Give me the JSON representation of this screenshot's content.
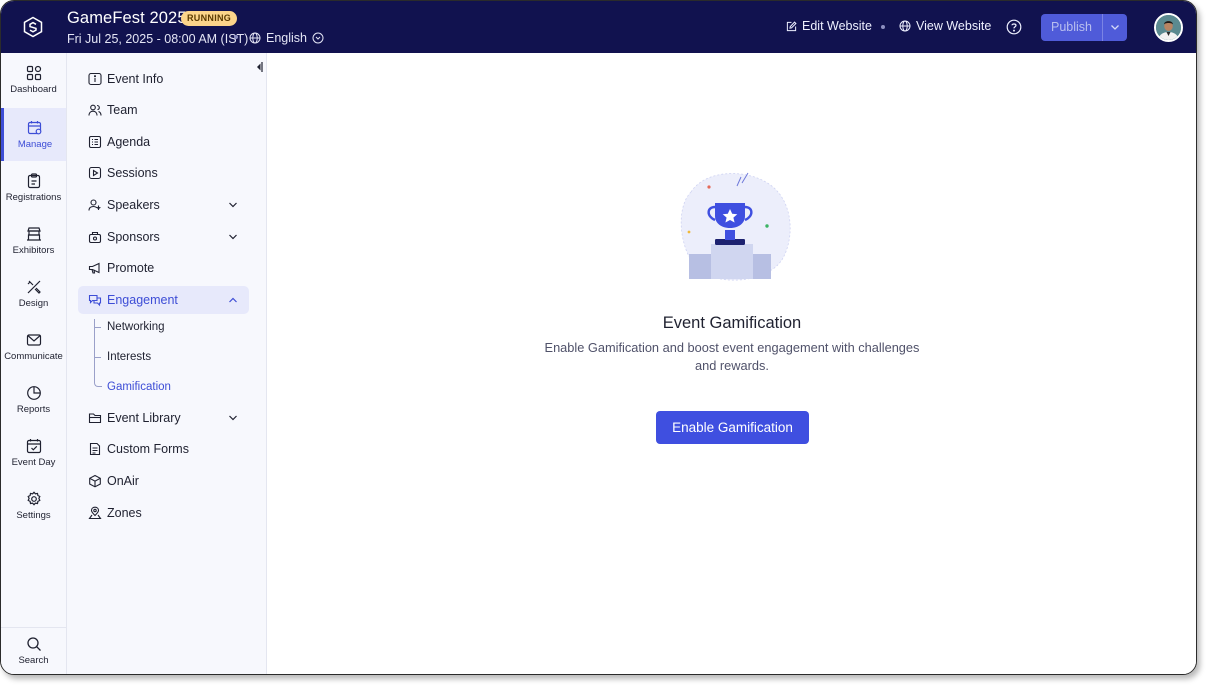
{
  "header": {
    "event_title": "GameFest 2025",
    "status_badge": "RUNNING",
    "event_date": "Fri Jul 25, 2025 - 08:00 AM (IST)",
    "language": "English",
    "edit_website": "Edit Website",
    "view_website": "View Website",
    "publish": "Publish"
  },
  "rail": {
    "items": [
      {
        "label": "Dashboard",
        "icon": "grid-icon"
      },
      {
        "label": "Manage",
        "icon": "calendar-gear-icon",
        "active": true
      },
      {
        "label": "Registrations",
        "icon": "clipboard-icon"
      },
      {
        "label": "Exhibitors",
        "icon": "booth-icon"
      },
      {
        "label": "Design",
        "icon": "pen-ruler-icon"
      },
      {
        "label": "Communicate",
        "icon": "envelope-icon"
      },
      {
        "label": "Reports",
        "icon": "pie-chart-icon"
      },
      {
        "label": "Event Day",
        "icon": "calendar-check-icon"
      },
      {
        "label": "Settings",
        "icon": "gear-icon"
      }
    ],
    "search": "Search"
  },
  "subnav": {
    "items": [
      {
        "label": "Event Info",
        "icon": "info-icon"
      },
      {
        "label": "Team",
        "icon": "people-icon"
      },
      {
        "label": "Agenda",
        "icon": "agenda-icon"
      },
      {
        "label": "Sessions",
        "icon": "play-icon"
      },
      {
        "label": "Speakers",
        "icon": "speaker-icon"
      },
      {
        "label": "Sponsors",
        "icon": "sponsor-icon"
      },
      {
        "label": "Promote",
        "icon": "megaphone-icon"
      },
      {
        "label": "Engagement",
        "icon": "chat-icon"
      },
      {
        "label": "Event Library",
        "icon": "folder-icon"
      },
      {
        "label": "Custom Forms",
        "icon": "form-icon"
      },
      {
        "label": "OnAir",
        "icon": "cube-icon"
      },
      {
        "label": "Zones",
        "icon": "map-pin-icon"
      }
    ],
    "engagement_children": [
      "Networking",
      "Interests",
      "Gamification"
    ]
  },
  "main": {
    "title": "Event Gamification",
    "description": "Enable Gamification and boost event engagement with challenges and rewards.",
    "button": "Enable Gamification"
  },
  "colors": {
    "topbar": "#11124f",
    "accent": "#3f4fe0",
    "badge": "#fcd58a"
  }
}
